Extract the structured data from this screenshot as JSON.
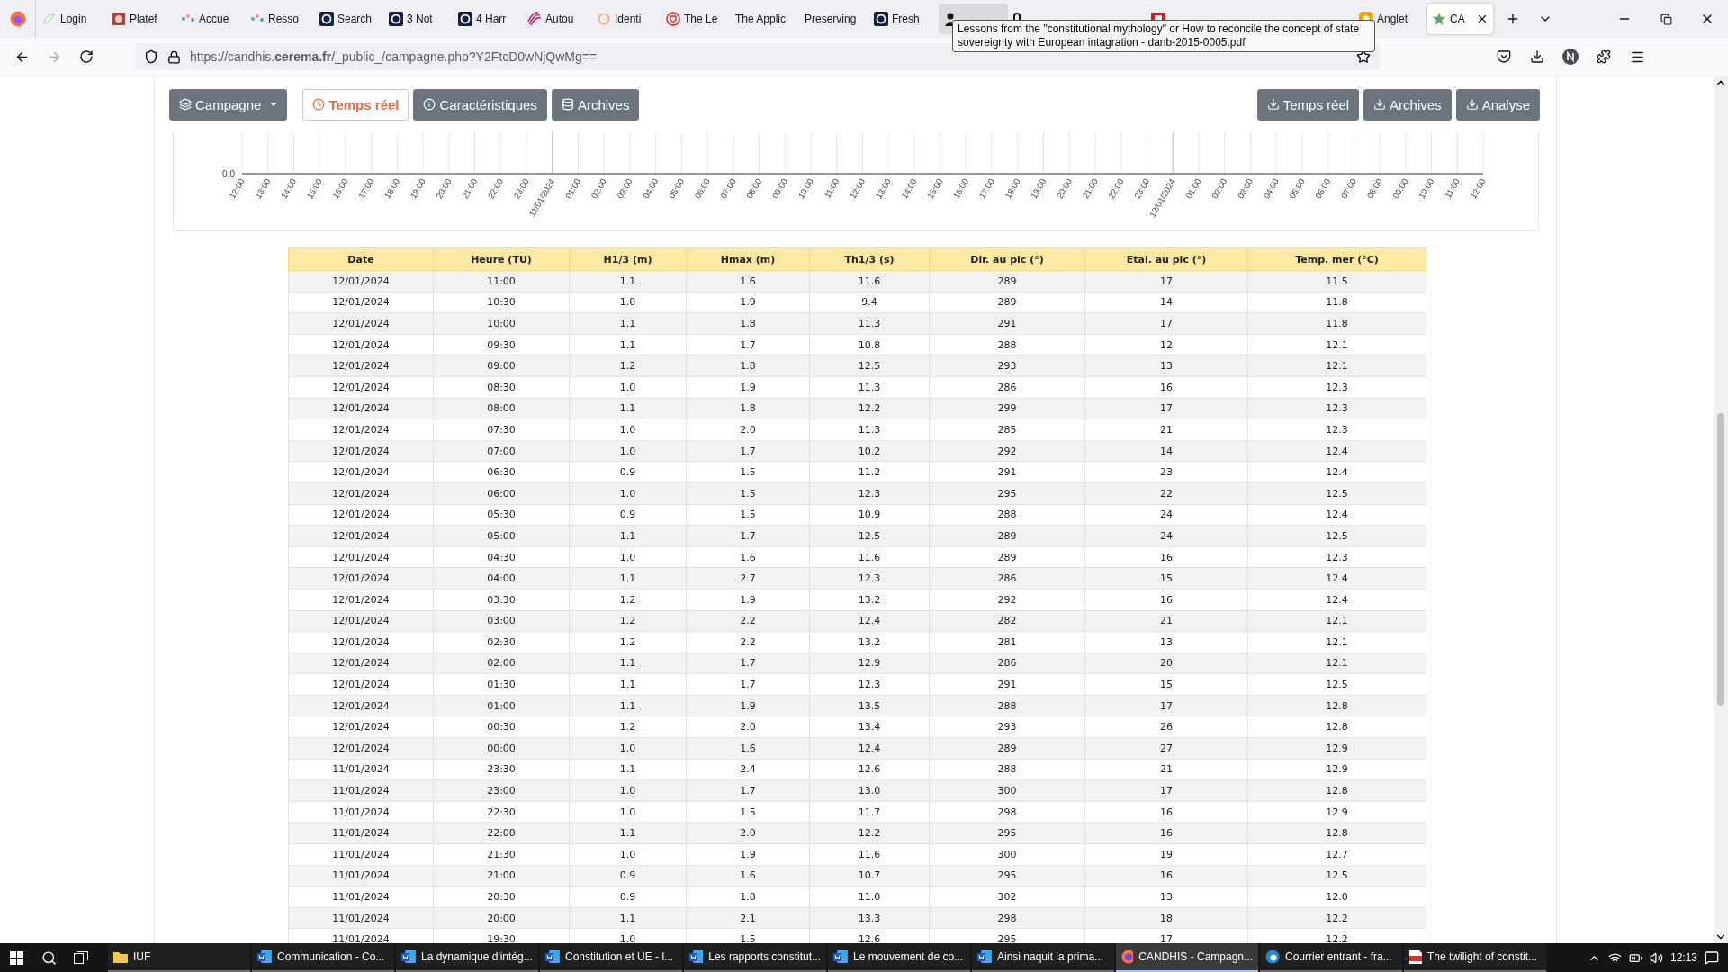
{
  "browser": {
    "tabs": [
      {
        "label": "Login",
        "kind": "cas",
        "selected": false,
        "hovered": false
      },
      {
        "label": "Platef",
        "kind": "photo",
        "selected": false,
        "hovered": false
      },
      {
        "label": "Accue",
        "kind": "sparkle",
        "selected": false,
        "hovered": false
      },
      {
        "label": "Resso",
        "kind": "sparkle",
        "selected": false,
        "hovered": false
      },
      {
        "label": "Search",
        "kind": "dark-ring",
        "selected": false,
        "hovered": false
      },
      {
        "label": "3 Not",
        "kind": "dark-ring",
        "selected": false,
        "hovered": false
      },
      {
        "label": "4 Harr",
        "kind": "dark-ring",
        "selected": false,
        "hovered": false
      },
      {
        "label": "Autou",
        "kind": "swirl",
        "selected": false,
        "hovered": false
      },
      {
        "label": "Identi",
        "kind": "ring",
        "selected": false,
        "hovered": false
      },
      {
        "label": "The Le",
        "kind": "shield",
        "selected": false,
        "hovered": false
      },
      {
        "label": "The Applic",
        "kind": "none",
        "selected": false,
        "hovered": false
      },
      {
        "label": "Preserving",
        "kind": "none",
        "selected": false,
        "hovered": false
      },
      {
        "label": "Fresh",
        "kind": "dark-ring",
        "selected": false,
        "hovered": false
      },
      {
        "kind": "person",
        "selected": false,
        "hovered": true
      },
      {
        "kind": "amazon",
        "selected": false,
        "hovered": false
      },
      {
        "kind": "none",
        "selected": false,
        "hovered": false
      },
      {
        "kind": "red-square",
        "selected": false,
        "hovered": false
      },
      {
        "kind": "none",
        "selected": false,
        "hovered": false
      },
      {
        "kind": "none",
        "selected": false,
        "hovered": false
      },
      {
        "label": "Anglet",
        "kind": "sun",
        "selected": false,
        "hovered": false
      },
      {
        "label": "CA",
        "kind": "star",
        "selected": true,
        "hovered": false
      }
    ],
    "tooltip": "Lessons from the \"constitutional mythology\" or How to reconcile the concept of state sovereignty with European intagration - danb-2015-0005.pdf",
    "url": "https://candhis.**cerema.fr**/_public_/campagne.php?Y2FtcD0wNjQwMg=="
  },
  "toolbar": {
    "left": [
      {
        "label": "Campagne",
        "kind": "layers",
        "dropdown": true,
        "selected": false
      },
      {
        "label": "Temps réel",
        "kind": "clock",
        "dropdown": false,
        "selected": true
      },
      {
        "label": "Caractéristiques",
        "kind": "info",
        "dropdown": false,
        "selected": false
      },
      {
        "label": "Archives",
        "kind": "database",
        "dropdown": false,
        "selected": false
      }
    ],
    "right": [
      {
        "label": "Temps réel",
        "kind": "download",
        "dropdown": false,
        "selected": false
      },
      {
        "label": "Archives",
        "kind": "download",
        "dropdown": false,
        "selected": false
      },
      {
        "label": "Analyse",
        "kind": "download",
        "dropdown": false,
        "selected": false
      }
    ]
  },
  "chart": {
    "y_tick": "0.0",
    "x_ticks": [
      "12:00",
      "13:00",
      "14:00",
      "15:00",
      "16:00",
      "17:00",
      "18:00",
      "19:00",
      "20:00",
      "21:00",
      "22:00",
      "23:00",
      "11/01/2024",
      "01:00",
      "02:00",
      "03:00",
      "04:00",
      "05:00",
      "06:00",
      "07:00",
      "08:00",
      "09:00",
      "10:00",
      "11:00",
      "12:00",
      "13:00",
      "14:00",
      "15:00",
      "16:00",
      "17:00",
      "18:00",
      "19:00",
      "20:00",
      "21:00",
      "22:00",
      "23:00",
      "12/01/2024",
      "01:00",
      "02:00",
      "03:00",
      "04:00",
      "05:00",
      "06:00",
      "07:00",
      "08:00",
      "09:00",
      "10:00",
      "11:00",
      "12:00"
    ]
  },
  "table": {
    "columns": [
      "Date",
      "Heure (TU)",
      "H1/3 (m)",
      "Hmax (m)",
      "Th1/3 (s)",
      "Dir. au pic (°)",
      "Etal. au pic (°)",
      "Temp. mer (°C)"
    ],
    "rows": [
      [
        "12/01/2024",
        "11:00",
        "1.1",
        "1.6",
        "11.6",
        "289",
        "17",
        "11.5"
      ],
      [
        "12/01/2024",
        "10:30",
        "1.0",
        "1.9",
        "9.4",
        "289",
        "14",
        "11.8"
      ],
      [
        "12/01/2024",
        "10:00",
        "1.1",
        "1.8",
        "11.3",
        "291",
        "17",
        "11.8"
      ],
      [
        "12/01/2024",
        "09:30",
        "1.1",
        "1.7",
        "10.8",
        "288",
        "12",
        "12.1"
      ],
      [
        "12/01/2024",
        "09:00",
        "1.2",
        "1.8",
        "12.5",
        "293",
        "13",
        "12.1"
      ],
      [
        "12/01/2024",
        "08:30",
        "1.0",
        "1.9",
        "11.3",
        "286",
        "16",
        "12.3"
      ],
      [
        "12/01/2024",
        "08:00",
        "1.1",
        "1.8",
        "12.2",
        "299",
        "17",
        "12.3"
      ],
      [
        "12/01/2024",
        "07:30",
        "1.0",
        "2.0",
        "11.3",
        "285",
        "21",
        "12.3"
      ],
      [
        "12/01/2024",
        "07:00",
        "1.0",
        "1.7",
        "10.2",
        "292",
        "14",
        "12.4"
      ],
      [
        "12/01/2024",
        "06:30",
        "0.9",
        "1.5",
        "11.2",
        "291",
        "23",
        "12.4"
      ],
      [
        "12/01/2024",
        "06:00",
        "1.0",
        "1.5",
        "12.3",
        "295",
        "22",
        "12.5"
      ],
      [
        "12/01/2024",
        "05:30",
        "0.9",
        "1.5",
        "10.9",
        "288",
        "24",
        "12.4"
      ],
      [
        "12/01/2024",
        "05:00",
        "1.1",
        "1.7",
        "12.5",
        "289",
        "24",
        "12.5"
      ],
      [
        "12/01/2024",
        "04:30",
        "1.0",
        "1.6",
        "11.6",
        "289",
        "16",
        "12.3"
      ],
      [
        "12/01/2024",
        "04:00",
        "1.1",
        "2.7",
        "12.3",
        "286",
        "15",
        "12.4"
      ],
      [
        "12/01/2024",
        "03:30",
        "1.2",
        "1.9",
        "13.2",
        "292",
        "16",
        "12.4"
      ],
      [
        "12/01/2024",
        "03:00",
        "1.2",
        "2.2",
        "12.4",
        "282",
        "21",
        "12.1"
      ],
      [
        "12/01/2024",
        "02:30",
        "1.2",
        "2.2",
        "13.2",
        "281",
        "13",
        "12.1"
      ],
      [
        "12/01/2024",
        "02:00",
        "1.1",
        "1.7",
        "12.9",
        "286",
        "20",
        "12.1"
      ],
      [
        "12/01/2024",
        "01:30",
        "1.1",
        "1.7",
        "12.3",
        "291",
        "15",
        "12.5"
      ],
      [
        "12/01/2024",
        "01:00",
        "1.1",
        "1.9",
        "13.5",
        "288",
        "17",
        "12.8"
      ],
      [
        "12/01/2024",
        "00:30",
        "1.2",
        "2.0",
        "13.4",
        "293",
        "26",
        "12.8"
      ],
      [
        "12/01/2024",
        "00:00",
        "1.0",
        "1.6",
        "12.4",
        "289",
        "27",
        "12.9"
      ],
      [
        "11/01/2024",
        "23:30",
        "1.1",
        "2.4",
        "12.6",
        "288",
        "21",
        "12.9"
      ],
      [
        "11/01/2024",
        "23:00",
        "1.0",
        "1.7",
        "13.0",
        "300",
        "17",
        "12.8"
      ],
      [
        "11/01/2024",
        "22:30",
        "1.0",
        "1.5",
        "11.7",
        "298",
        "16",
        "12.9"
      ],
      [
        "11/01/2024",
        "22:00",
        "1.1",
        "2.0",
        "12.2",
        "295",
        "16",
        "12.8"
      ],
      [
        "11/01/2024",
        "21:30",
        "1.0",
        "1.9",
        "11.6",
        "300",
        "19",
        "12.7"
      ],
      [
        "11/01/2024",
        "21:00",
        "0.9",
        "1.6",
        "10.7",
        "295",
        "16",
        "12.5"
      ],
      [
        "11/01/2024",
        "20:30",
        "0.9",
        "1.8",
        "11.0",
        "302",
        "13",
        "12.0"
      ],
      [
        "11/01/2024",
        "20:00",
        "1.1",
        "2.1",
        "13.3",
        "298",
        "18",
        "12.2"
      ],
      [
        "11/01/2024",
        "19:30",
        "1.0",
        "1.5",
        "12.6",
        "295",
        "17",
        "12.2"
      ]
    ]
  },
  "taskbar": {
    "items": [
      {
        "label": "IUF",
        "kind": "folder",
        "selected": false
      },
      {
        "label": "Communication - Co...",
        "kind": "word",
        "selected": false
      },
      {
        "label": "La dynamique d'intég...",
        "kind": "word",
        "selected": false
      },
      {
        "label": "Constitution et UE - l...",
        "kind": "word",
        "selected": false
      },
      {
        "label": "Les rapports constitut...",
        "kind": "word",
        "selected": false
      },
      {
        "label": "Le mouvement de co...",
        "kind": "word",
        "selected": false
      },
      {
        "label": "Ainsi naquit la prima...",
        "kind": "word",
        "selected": false
      },
      {
        "label": "CANDHIS - Campagn...",
        "kind": "firefox",
        "selected": true
      },
      {
        "label": "Courrier entrant - fra...",
        "kind": "mail",
        "selected": false
      },
      {
        "label": "The twilight of constit...",
        "kind": "pdf",
        "selected": false
      }
    ],
    "time": "12:13"
  }
}
